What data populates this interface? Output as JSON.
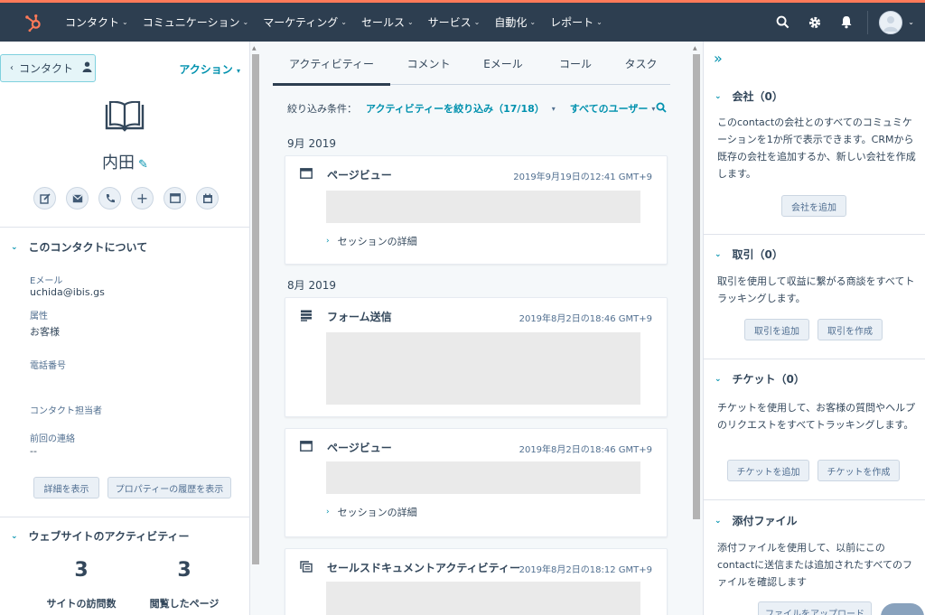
{
  "nav": {
    "items": [
      {
        "label": "コンタクト"
      },
      {
        "label": "コミュニケーション"
      },
      {
        "label": "マーケティング"
      },
      {
        "label": "セールス"
      },
      {
        "label": "サービス"
      },
      {
        "label": "自動化"
      },
      {
        "label": "レポート"
      }
    ],
    "brand_color": "#ff7a59",
    "bar_color": "#2d3e50"
  },
  "left": {
    "back_label": "コンタクト",
    "action_label": "アクション",
    "contact_name": "内田",
    "quick_actions": [
      "note-icon",
      "email-icon",
      "call-icon",
      "add-icon",
      "log-icon",
      "meeting-icon"
    ],
    "about": {
      "title": "このコンタクトについて",
      "props": [
        {
          "label": "Eメール",
          "value": "uchida@ibis.gs"
        },
        {
          "label": "属性",
          "value": "お客様"
        },
        {
          "label": "電話番号",
          "value": ""
        },
        {
          "label": "コンタクト担当者",
          "value": ""
        },
        {
          "label": "前回の連絡",
          "value": "--"
        }
      ],
      "details_button": "詳細を表示",
      "history_button": "プロパティーの履歴を表示"
    },
    "web": {
      "title": "ウェブサイトのアクティビティー",
      "visits": "3",
      "visits_label": "サイトの訪問数",
      "pages": "3",
      "pages_label": "閲覧したページ"
    }
  },
  "middle": {
    "tabs": [
      {
        "label": "アクティビティー",
        "active": true
      },
      {
        "label": "コメント"
      },
      {
        "label": "Eメール"
      },
      {
        "label": "コール"
      },
      {
        "label": "タスク"
      }
    ],
    "filter_label": "絞り込み条件：",
    "filter_activity": "アクティビティーを絞り込み（17/18）",
    "filter_users": "すべてのユーザー",
    "months": [
      "9月 2019",
      "8月 2019"
    ],
    "cards": [
      {
        "title": "ページビュー",
        "time": "2019年9月19日の12:41 GMT+9",
        "link": "セッションの詳細"
      },
      {
        "title": "フォーム送信",
        "time": "2019年8月2日の18:46 GMT+9"
      },
      {
        "title": "ページビュー",
        "time": "2019年8月2日の18:46 GMT+9",
        "link": "セッションの詳細"
      },
      {
        "title": "セールスドキュメントアクティビティー",
        "time": "2019年8月2日の18:12 GMT+9"
      }
    ]
  },
  "right": {
    "company": {
      "title": "会社（0）",
      "text": "このcontactの会社とのすべてのコミュミケーションを1か所で表示できます。CRMから既存の会社を追加するか、新しい会社を作成します。",
      "add_button": "会社を追加"
    },
    "deal": {
      "title": "取引（0）",
      "text": "取引を使用して収益に繋がる商談をすべてトラッキングします。",
      "add_button": "取引を追加",
      "create_button": "取引を作成"
    },
    "ticket": {
      "title": "チケット（0）",
      "text": "チケットを使用して、お客様の質問やヘルプのリクエストをすべてトラッキングします。",
      "add_button": "チケットを追加",
      "create_button": "チケットを作成"
    },
    "attach": {
      "title": "添付ファイル",
      "text": "添付ファイルを使用して、以前にこのcontactに送信または追加されたすべてのファイルを確認します",
      "upload_button": "ファイルをアップロード"
    }
  }
}
